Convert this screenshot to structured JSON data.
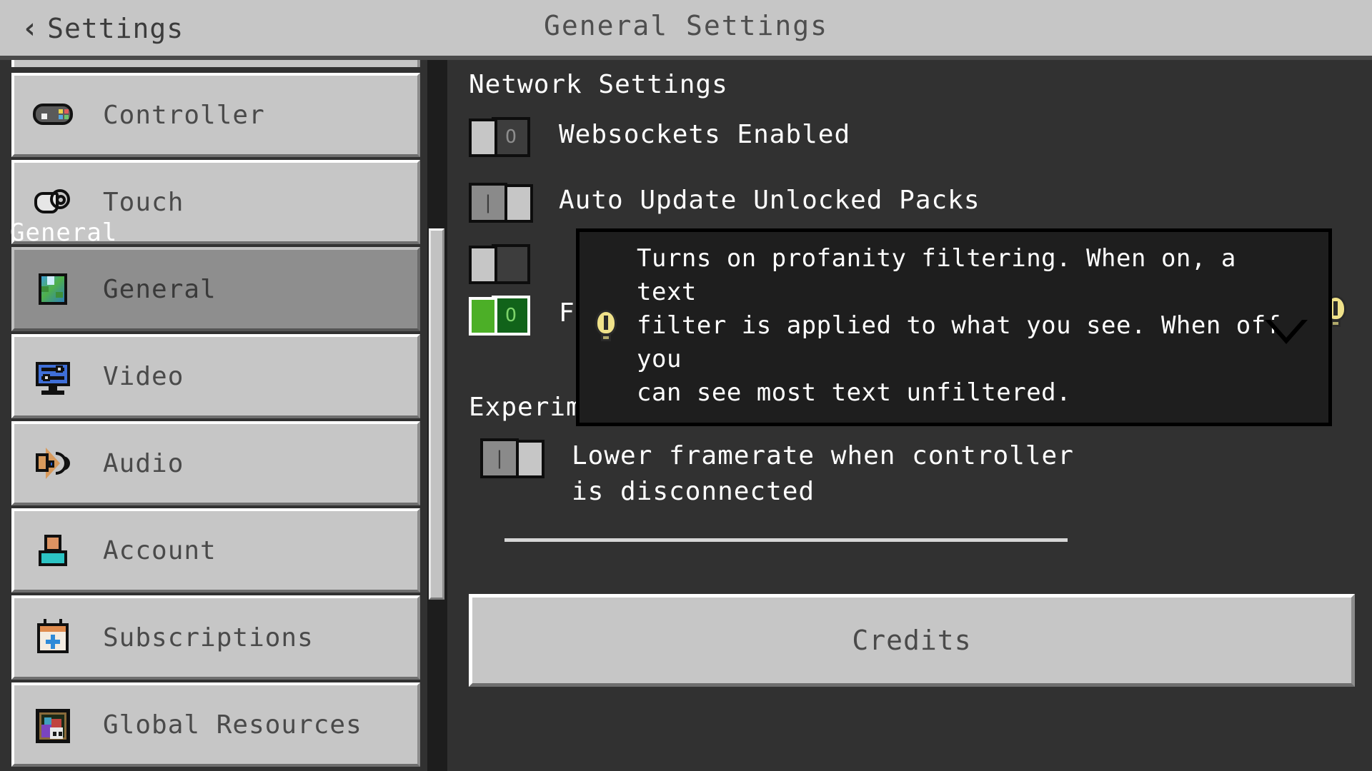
{
  "header": {
    "back_label": "Settings",
    "back_icon": "chevron-left-icon",
    "title": "General Settings"
  },
  "sidebar": {
    "items_top": [
      {
        "label": "Controller",
        "icon": "controller-icon",
        "selected": false
      },
      {
        "label": "Touch",
        "icon": "touch-hand-icon",
        "selected": false
      }
    ],
    "section_label": "General",
    "items_general": [
      {
        "label": "General",
        "icon": "globe-cube-icon",
        "selected": true
      },
      {
        "label": "Video",
        "icon": "monitor-icon",
        "selected": false
      },
      {
        "label": "Audio",
        "icon": "speaker-icon",
        "selected": false
      },
      {
        "label": "Account",
        "icon": "person-icon",
        "selected": false
      },
      {
        "label": "Subscriptions",
        "icon": "calendar-plus-icon",
        "selected": false
      },
      {
        "label": "Global Resources",
        "icon": "painting-icon",
        "selected": false
      }
    ]
  },
  "panel": {
    "network_heading": "Network Settings",
    "options": [
      {
        "label": "Websockets Enabled",
        "state": "off",
        "glyph": "O"
      },
      {
        "label": "Auto Update Unlocked Packs",
        "state": "gray-right",
        "glyph": "|"
      },
      {
        "label": "Filter Profanity",
        "state": "on-green",
        "glyph": "O"
      }
    ],
    "experimental_heading": "Experimental Power-Saving Features",
    "framerate_option": {
      "label": "Lower framerate when controller is disconnected",
      "state": "gray-right",
      "glyph": "|"
    },
    "credits_label": "Credits"
  },
  "tooltip": {
    "icon": "info-bulb-icon",
    "line1": "Turns on profanity filtering. When on, a text",
    "line2": "filter is applied to what you see. When off, you",
    "line3": "can see most text unfiltered."
  },
  "colors": {
    "panel_bg": "#313131",
    "chrome_gray": "#c6c6c6",
    "selected_gray": "#8e8e8e",
    "toggle_on_green": "#4caf27",
    "toggle_track_green": "#11631a",
    "tooltip_bg": "#1e1e1e",
    "info_yellow": "#f0e28a"
  }
}
